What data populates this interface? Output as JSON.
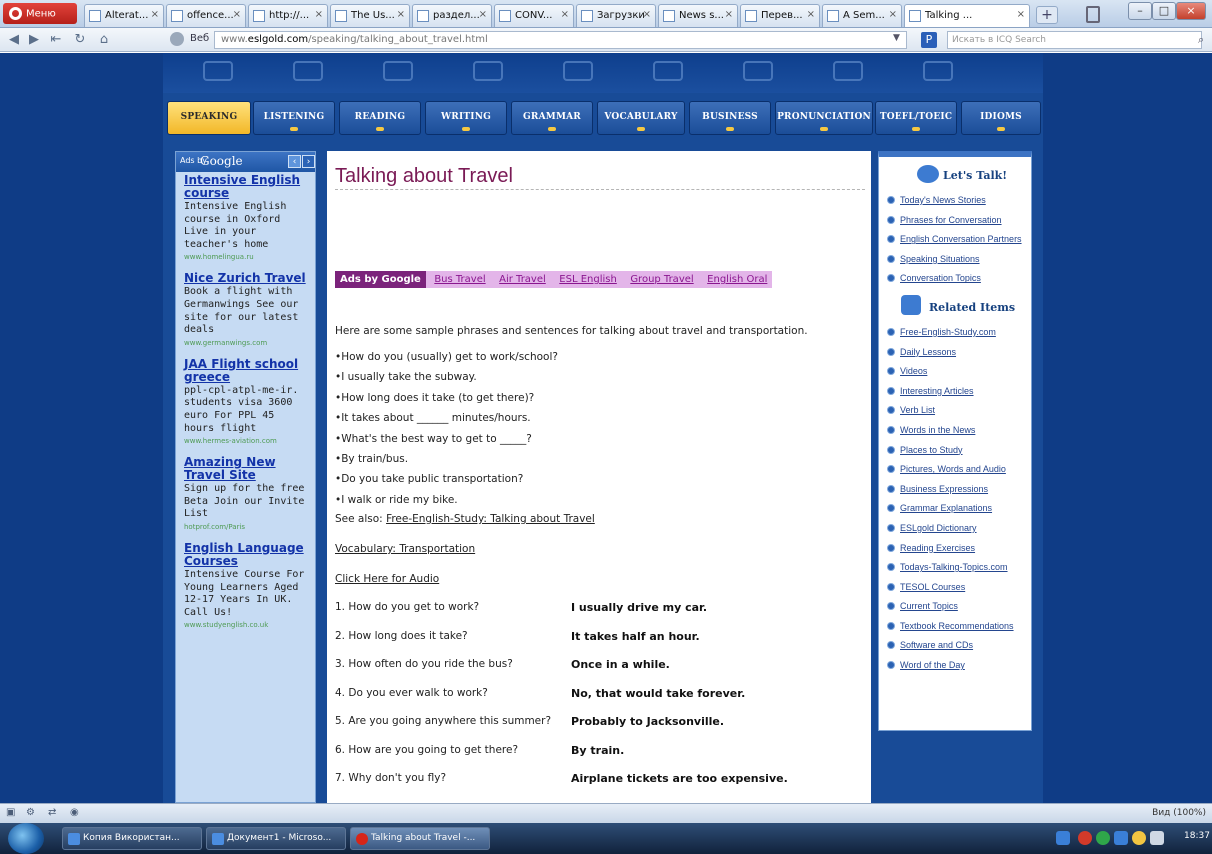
{
  "browser": {
    "menu_label": "Меню",
    "tabs": [
      {
        "title": "Alterat..."
      },
      {
        "title": "offence..."
      },
      {
        "title": "http://..."
      },
      {
        "title": "The Us..."
      },
      {
        "title": "раздел..."
      },
      {
        "title": "CONV..."
      },
      {
        "title": "Загрузки"
      },
      {
        "title": "News s..."
      },
      {
        "title": "Перев..."
      },
      {
        "title": "A Sem..."
      },
      {
        "title": "Talking ..."
      }
    ],
    "speed_label": "Веб",
    "address_prefix": "www.",
    "address_domain": "eslgold.com",
    "address_path": "/speaking/talking_about_travel.html",
    "search_placeholder": "Искать в ICQ Search",
    "zoom_label": "Вид (100%)"
  },
  "site": {
    "nav_tabs": [
      "SPEAKING",
      "LISTENING",
      "READING",
      "WRITING",
      "GRAMMAR",
      "VOCABULARY",
      "BUSINESS",
      "PRONUNCIATION",
      "TOEFL/TOEIC",
      "IDIOMS"
    ],
    "active_tab": "SPEAKING",
    "left_ads_header_prefix": "Ads by",
    "left_ads_header_brand": "Google",
    "left_ads": [
      {
        "title": "Intensive English course",
        "body": "Intensive English course in Oxford Live in your teacher's home",
        "url": "www.homelingua.ru"
      },
      {
        "title": "Nice Zurich Travel",
        "body": "Book a flight with Germanwings See our site for our latest deals",
        "url": "www.germanwings.com"
      },
      {
        "title": "JAA Flight school greece",
        "body": "ppl-cpl-atpl-me-ir. students visa 3600 euro For PPL 45 hours flight",
        "url": "www.hermes-aviation.com"
      },
      {
        "title": "Amazing New Travel Site",
        "body": "Sign up for the free Beta Join our Invite List",
        "url": "hotprof.com/Paris"
      },
      {
        "title": "English Language Courses",
        "body": "Intensive Course For Young Learners Aged 12-17 Years In UK. Call Us!",
        "url": "www.studyenglish.co.uk"
      }
    ],
    "page_title": "Talking about Travel",
    "ad_links_label": "Ads by Google",
    "ad_links": [
      "Bus Travel",
      "Air Travel",
      "ESL English",
      "Group Travel",
      "English Oral"
    ],
    "intro": "Here are some sample phrases and sentences for talking about travel and transportation.",
    "phrases": [
      "How do you (usually) get to work/school?",
      "I usually take the subway.",
      "How long does it take (to get there)?",
      "It takes about ______ minutes/hours.",
      "What's the best way to get to _____?",
      "By train/bus.",
      "Do you take public transportation?",
      "I walk or ride my bike."
    ],
    "see_also_prefix": "See also:",
    "see_also_link": "Free-English-Study: Talking about Travel",
    "vocab_link": "Vocabulary: Transportation",
    "audio_link": "Click Here for Audio",
    "dialog": [
      {
        "q": "1. How do you get to work?",
        "a": "I usually drive my car."
      },
      {
        "q": "2. How long does it take?",
        "a": "It takes half an hour."
      },
      {
        "q": "3. How often do you ride the bus?",
        "a": "Once in a while."
      },
      {
        "q": "4. Do you ever walk to work?",
        "a": "No, that would take forever."
      },
      {
        "q": "5. Are you going anywhere this summer?",
        "a": "Probably to Jacksonville."
      },
      {
        "q": "6. How are you going to get there?",
        "a": "By train."
      },
      {
        "q": "7. Why don't you fly?",
        "a": "Airplane tickets are too expensive."
      }
    ],
    "lets_talk_title": "Let's Talk!",
    "lets_talk_links": [
      "Today's News Stories",
      "Phrases for Conversation",
      "English Conversation Partners",
      "Speaking Situations",
      "Conversation Topics"
    ],
    "related_title": "Related Items",
    "related_links": [
      "Free-English-Study.com",
      "Daily Lessons",
      "Videos",
      "Interesting Articles",
      "Verb List",
      "Words in the News",
      "Places to Study",
      "Pictures, Words and Audio",
      "Business Expressions",
      "Grammar Explanations",
      "ESLgold Dictionary",
      "Reading Exercises",
      "Todays-Talking-Topics.com",
      "TESOL Courses",
      "Current Topics",
      "Textbook Recommendations",
      "Software and CDs",
      "Word of the Day"
    ]
  },
  "taskbar": {
    "items": [
      {
        "label": "Копия Використан..."
      },
      {
        "label": "Документ1 - Microso..."
      },
      {
        "label": "Talking about Travel -..."
      }
    ],
    "clock": "18:37"
  },
  "colors": {
    "page_bg": "#113c88",
    "title": "#7a1a55",
    "active_tab": "#f2b728",
    "ad_link_bg": "#e3b5e9"
  }
}
